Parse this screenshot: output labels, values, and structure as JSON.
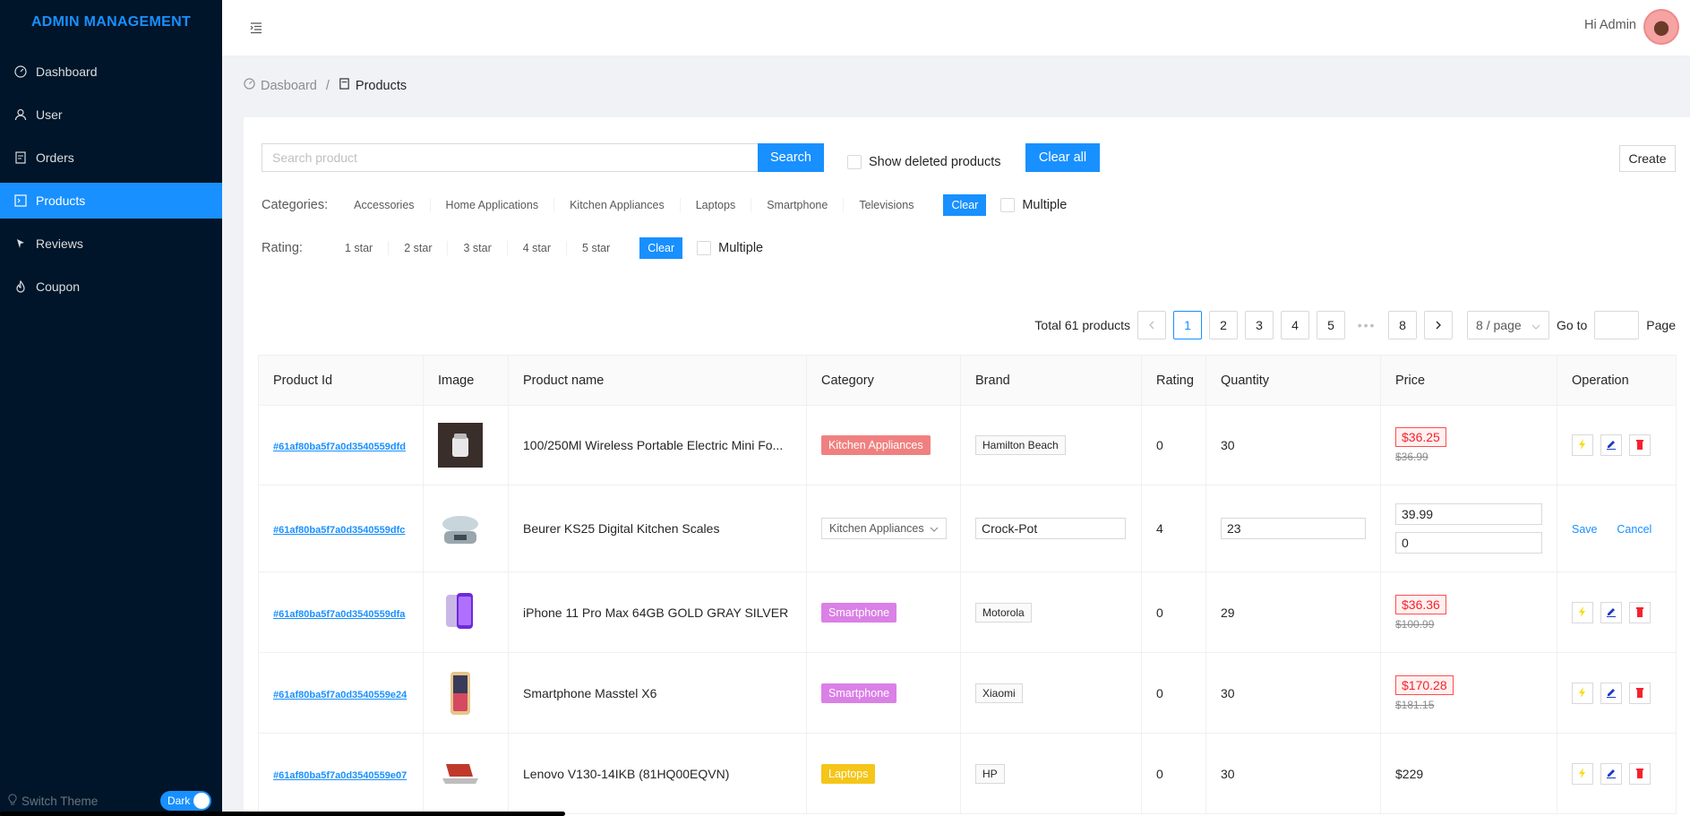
{
  "app": {
    "title": "ADMIN MANAGEMENT"
  },
  "sidebar": {
    "items": [
      {
        "label": "Dashboard",
        "icon": "dashboard-icon"
      },
      {
        "label": "User",
        "icon": "user-icon"
      },
      {
        "label": "Orders",
        "icon": "orders-icon"
      },
      {
        "label": "Products",
        "icon": "products-icon",
        "active": true
      },
      {
        "label": "Reviews",
        "icon": "reviews-icon"
      },
      {
        "label": "Coupon",
        "icon": "coupon-icon"
      }
    ],
    "theme_label": "Switch Theme",
    "theme_value": "Dark"
  },
  "header": {
    "greeting": "Hi Admin"
  },
  "breadcrumb": {
    "home": "Dasboard",
    "separator": "/",
    "current": "Products"
  },
  "toolbar": {
    "search_placeholder": "Search product",
    "search_label": "Search",
    "show_deleted_label": "Show deleted products",
    "clear_all_label": "Clear all",
    "create_label": "Create"
  },
  "filters": {
    "categories_label": "Categories:",
    "categories": [
      "Accessories",
      "Home Applications",
      "Kitchen Appliances",
      "Laptops",
      "Smartphone",
      "Televisions"
    ],
    "clear_label": "Clear",
    "multiple_label": "Multiple",
    "rating_label": "Rating:",
    "ratings": [
      "1 star",
      "2 star",
      "3 star",
      "4 star",
      "5 star"
    ]
  },
  "pagination": {
    "total_text": "Total 61 products",
    "pages": [
      "1",
      "2",
      "3",
      "4",
      "5"
    ],
    "ellipsis": "•••",
    "last_page": "8",
    "current": 1,
    "page_size": "8 / page",
    "goto_label": "Go to",
    "page_label": "Page"
  },
  "table": {
    "columns": [
      "Product Id",
      "Image",
      "Product name",
      "Category",
      "Brand",
      "Rating",
      "Quantity",
      "Price",
      "Operation"
    ],
    "rows": [
      {
        "id": "#61af80ba5f7a0d3540559dfd",
        "name": "100/250Ml Wireless Portable Electric Mini Fo...",
        "category": "Kitchen Appliances",
        "brand": "Hamilton Beach",
        "rating": "0",
        "quantity": "30",
        "price": "$36.25",
        "old_price": "$36.99"
      },
      {
        "id": "#61af80ba5f7a0d3540559dfc",
        "name": "Beurer KS25 Digital Kitchen Scales",
        "category": "Kitchen Appliances",
        "brand": "Crock-Pot",
        "rating": "4",
        "quantity": "23",
        "price": "39.99",
        "discount": "0",
        "save_label": "Save",
        "cancel_label": "Cancel"
      },
      {
        "id": "#61af80ba5f7a0d3540559dfa",
        "name": "iPhone 11 Pro Max 64GB GOLD GRAY SILVER",
        "category": "Smartphone",
        "brand": "Motorola",
        "rating": "0",
        "quantity": "29",
        "price": "$36.36",
        "old_price": "$100.99"
      },
      {
        "id": "#61af80ba5f7a0d3540559e24",
        "name": "Smartphone Masstel X6",
        "category": "Smartphone",
        "brand": "Xiaomi",
        "rating": "0",
        "quantity": "30",
        "price": "$170.28",
        "old_price": "$181.15"
      },
      {
        "id": "#61af80ba5f7a0d3540559e07",
        "name": "Lenovo V130-14IKB (81HQ00EQVN)",
        "category": "Laptops",
        "brand": "HP",
        "rating": "0",
        "quantity": "30",
        "price": "$229"
      }
    ]
  },
  "colors": {
    "primary": "#1890ff",
    "sidebar_bg": "#001529",
    "kitchen_badge": "#f08080",
    "smartphone_badge": "#da80e6",
    "laptops_badge": "#f5c518",
    "sale_red": "#f5222d"
  }
}
